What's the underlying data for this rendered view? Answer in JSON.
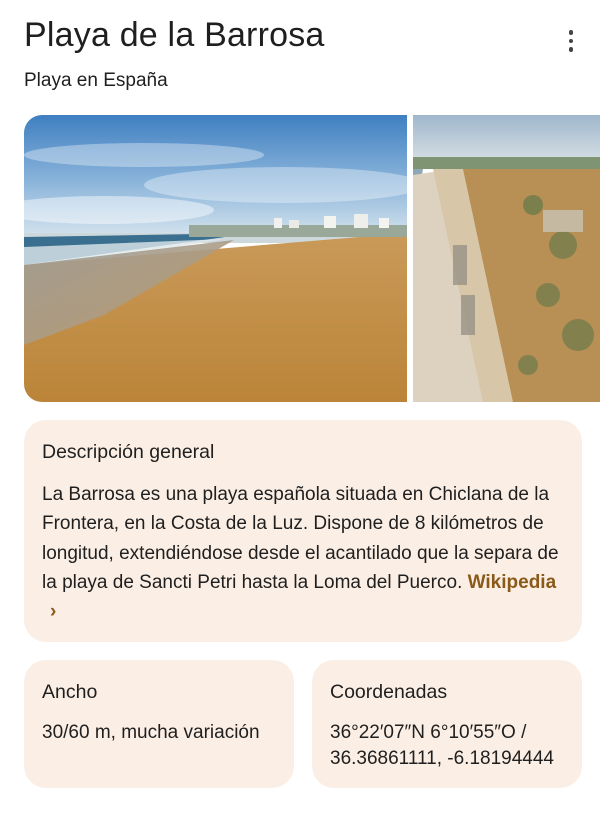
{
  "header": {
    "title": "Playa de la Barrosa",
    "subtitle": "Playa en España"
  },
  "icons": {
    "more": "more-vert-icon"
  },
  "overview": {
    "heading": "Descripción general",
    "text": "La Barrosa es una playa española situada en Chiclana de la Frontera, en la Costa de la Luz. Dispone de 8 kilómetros de longitud, extendiéndose desde el acantilado que la separa de la playa de Sancti Petri hasta la Loma del Puerco.",
    "source_label": "Wikipedia",
    "source_chevron": "›"
  },
  "facts": {
    "width": {
      "label": "Ancho",
      "value": "30/60 m, mucha variación"
    },
    "coords": {
      "label": "Coordenadas",
      "value": "36°22′07″N 6°10′55″O / 36.36861111, -6.18194444"
    }
  },
  "colors": {
    "card_bg": "#fbeee4",
    "link": "#8a5a1a",
    "sand": "#c8944f",
    "sky": "#5a93c9"
  }
}
